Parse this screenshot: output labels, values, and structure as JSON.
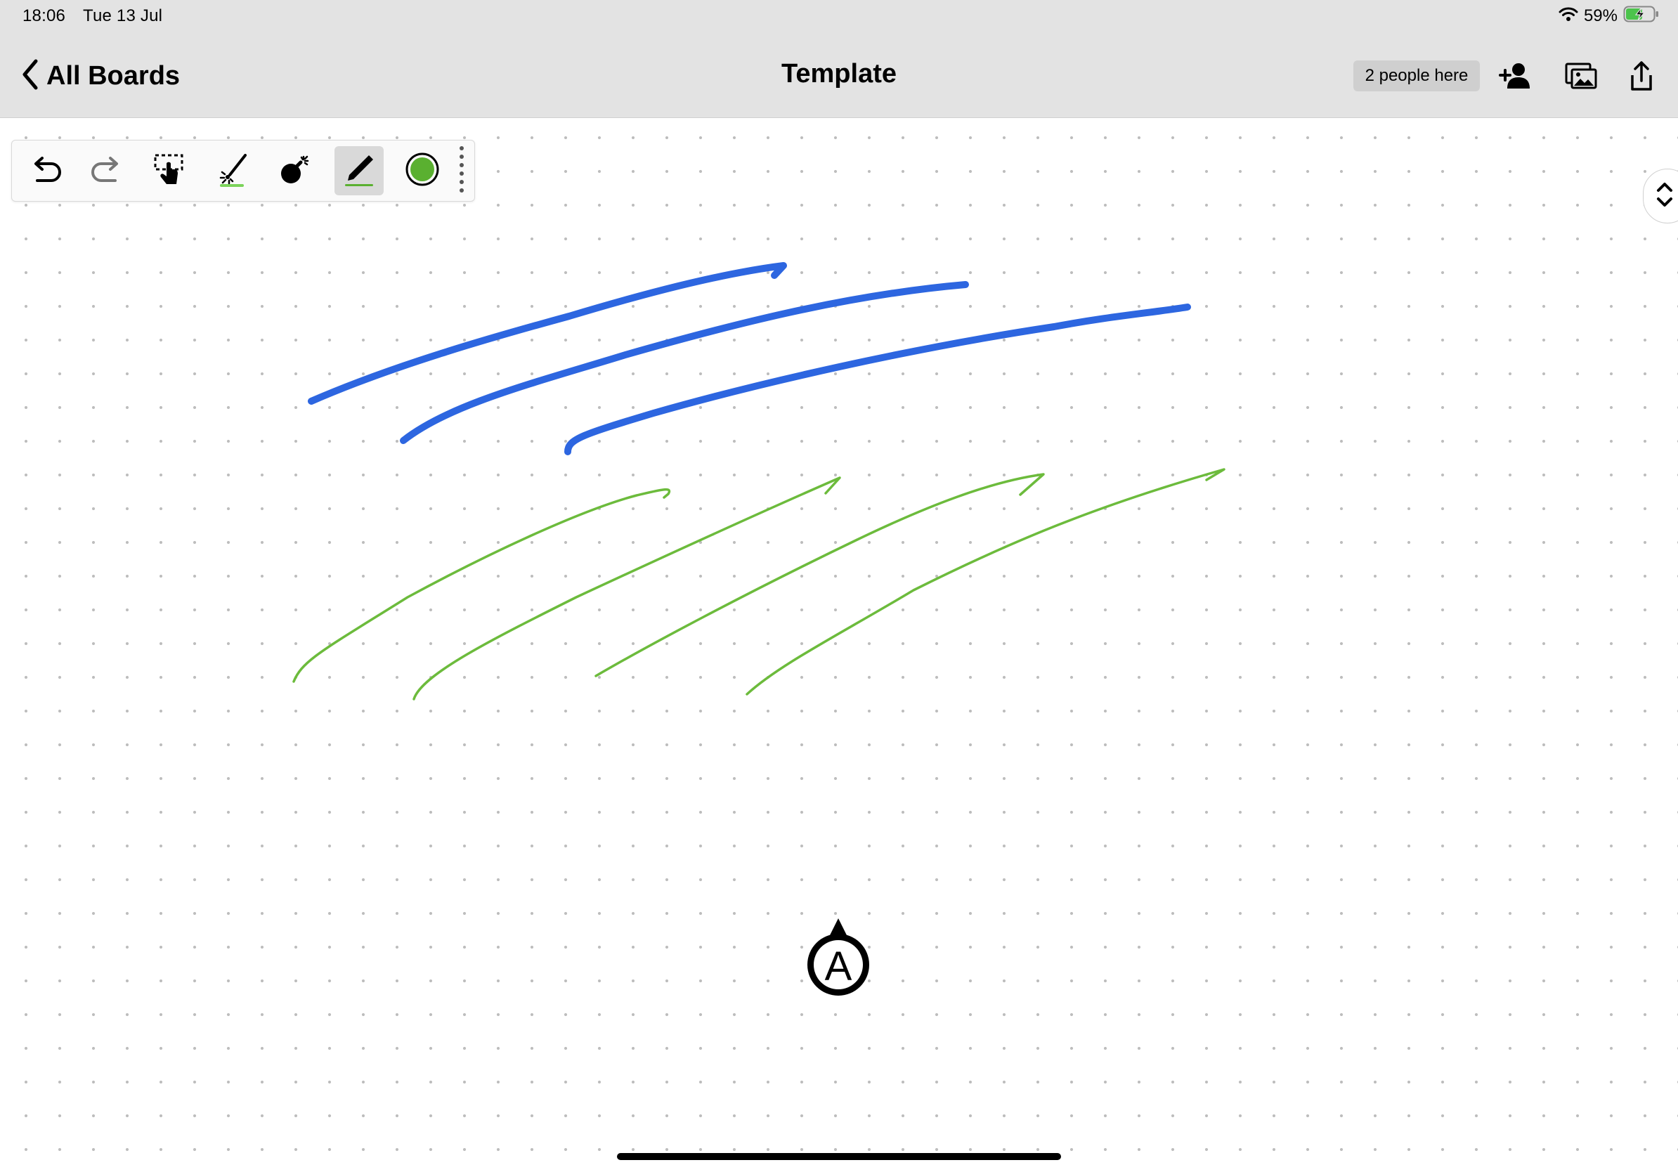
{
  "status_bar": {
    "time": "18:06",
    "date": "Tue 13 Jul",
    "battery": "59%",
    "wifi_icon": "wifi-icon",
    "battery_icon": "battery-charging-icon"
  },
  "header": {
    "back_label": "All Boards",
    "title": "Template",
    "people_badge": "2 people here",
    "icons": [
      "chevron-left-icon",
      "add-person-icon",
      "image-gallery-icon",
      "share-icon"
    ]
  },
  "toolbar": {
    "tools": [
      "undo",
      "redo",
      "lasso-select",
      "magic-pen",
      "eraser-bomb",
      "pen",
      "color-picker",
      "more"
    ],
    "active_tool": "pen",
    "active_color": "#5ab030"
  },
  "colors": {
    "stroke_blue": "#2d66e0",
    "stroke_green": "#6cbb3c",
    "header_bg": "#e3e3e3",
    "grid_dot": "#bdbdbd"
  },
  "collaborator": {
    "initial": "A"
  }
}
